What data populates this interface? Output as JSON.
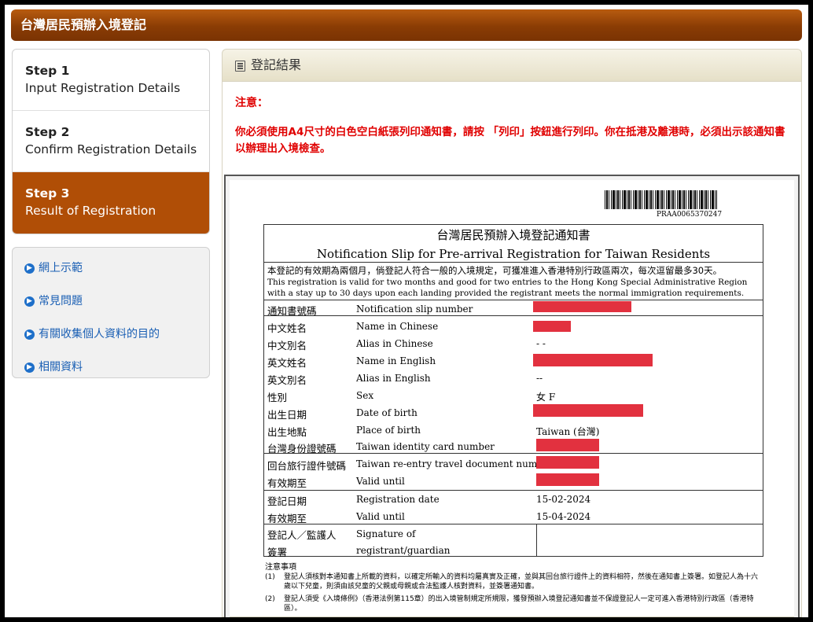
{
  "header": {
    "title": "台灣居民預辦入境登記"
  },
  "steps": [
    {
      "num": "Step 1",
      "desc": "Input Registration Details"
    },
    {
      "num": "Step 2",
      "desc": "Confirm Registration Details"
    },
    {
      "num": "Step 3",
      "desc": "Result of Registration"
    }
  ],
  "links": [
    "網上示範",
    "常見問題",
    "有關收集個人資料的目的",
    "相關資料"
  ],
  "panel": {
    "title": "登記結果",
    "notice_label": "注意：",
    "notice_text": "你必須使用A4尺寸的白色空白紙張列印通知書，請按 「列印」按鈕進行列印。你在抵港及離港時，必須出示該通知書以辦理出入境檢查。"
  },
  "slip": {
    "barcode_number": "PRAA0065370247",
    "title_zh": "台灣居民預辦入境登記通知書",
    "title_en": "Notification Slip for Pre-arrival Registration for Taiwan Residents",
    "validity_zh": "本登記的有效期為兩個月，倘登記人符合一般的入境規定，可獲准進入香港特別行政區兩次，每次逗留最多30天。",
    "validity_en": "This registration is valid for two months and good for two entries to the Hong Kong Special Administrative Region with a stay up to 30 days upon each landing provided the registrant meets the normal immigration requirements.",
    "rows": [
      {
        "zh": "通知書號碼",
        "en": "Notification slip number",
        "value": ""
      },
      {
        "zh": "中文姓名",
        "en": "Name in Chinese",
        "value": ""
      },
      {
        "zh": "中文別名",
        "en": "Alias in Chinese",
        "value": "- -"
      },
      {
        "zh": "英文姓名",
        "en": "Name in English",
        "value": ""
      },
      {
        "zh": "英文別名",
        "en": "Alias in English",
        "value": "--"
      },
      {
        "zh": "性別",
        "en": "Sex",
        "value": "女 F"
      },
      {
        "zh": "出生日期",
        "en": "Date of birth",
        "value": ""
      },
      {
        "zh": "出生地點",
        "en": "Place of birth",
        "value": "Taiwan (台灣)"
      },
      {
        "zh": "台灣身份證號碼",
        "en": "Taiwan identity card number",
        "value": ""
      },
      {
        "zh": "回台旅行證件號碼",
        "en": "Taiwan re-entry travel document number",
        "value": ""
      },
      {
        "zh": "有效期至",
        "en": "Valid until",
        "value": ""
      },
      {
        "zh": "登記日期",
        "en": "Registration date",
        "value": "15-02-2024"
      },
      {
        "zh": "有效期至",
        "en": "Valid until",
        "value": "15-04-2024"
      }
    ],
    "signature": {
      "zh_line1": "登記人／監護人",
      "zh_line2": "簽署",
      "en_line1": "Signature of",
      "en_line2": "registrant/guardian"
    },
    "notes_title": "注意事項",
    "notes": [
      {
        "num": "(1)",
        "text": "登記人須核對本通知書上所載的資料，以確定所輸入的資料均屬真實及正確，並與其回台旅行證件上的資料相符，然後在通知書上簽署。如登記人為十六歲以下兒童，則須由該兒童的父親或母親或合法監護人核對資料，並簽署通知書。"
      },
      {
        "num": "(2)",
        "text": "登記人須受《入境條例》（香港法例第115章）的出入境管制規定所規限，獲發預辦入境登記通知書並不保證登記人一定可進入香港特別行政區（香港特區）。"
      }
    ]
  },
  "colors": {
    "header": "#8a3c04",
    "active_step": "#b04e06",
    "notice": "#e00000",
    "redaction": "#e2313f",
    "link": "#1a5fb4"
  }
}
